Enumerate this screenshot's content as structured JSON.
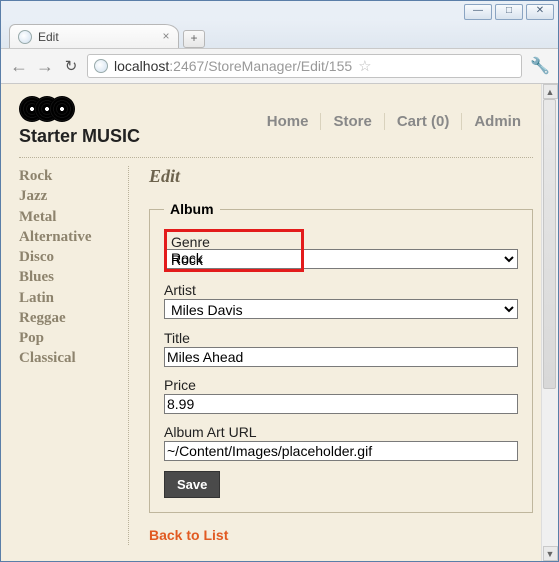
{
  "window": {
    "tab_title": "Edit",
    "url_prefix": "localhost",
    "url_rest": ":2467/StoreManager/Edit/155"
  },
  "brand": {
    "name": "Starter MUSIC"
  },
  "topnav": {
    "home": "Home",
    "store": "Store",
    "cart": "Cart (0)",
    "admin": "Admin"
  },
  "sidebar": {
    "items": [
      "Rock",
      "Jazz",
      "Metal",
      "Alternative",
      "Disco",
      "Blues",
      "Latin",
      "Reggae",
      "Pop",
      "Classical"
    ]
  },
  "page": {
    "heading": "Edit",
    "legend": "Album",
    "genre_label": "Genre",
    "genre_value": "Rock",
    "artist_label": "Artist",
    "artist_value": "Miles Davis",
    "title_label": "Title",
    "title_value": "Miles Ahead",
    "price_label": "Price",
    "price_value": "8.99",
    "arturl_label": "Album Art URL",
    "arturl_value": "~/Content/Images/placeholder.gif",
    "save_label": "Save",
    "back_label": "Back to List"
  }
}
